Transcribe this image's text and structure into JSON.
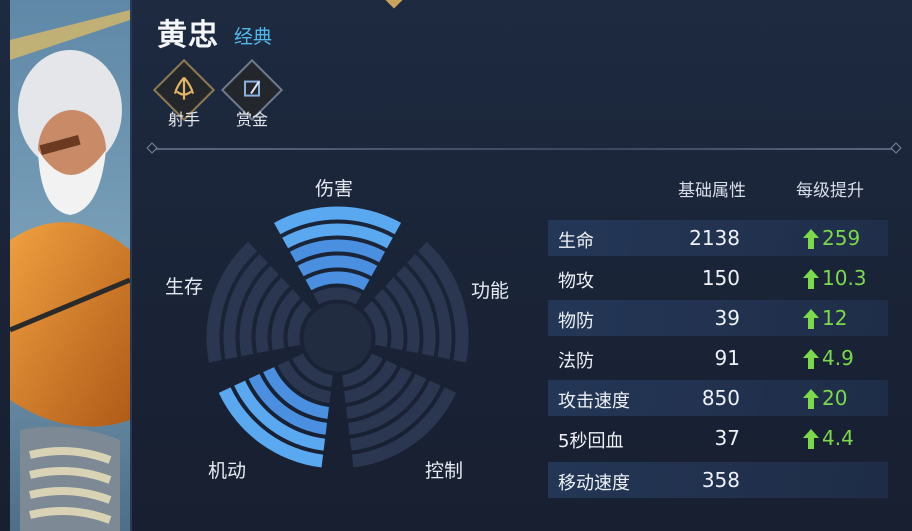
{
  "hero": {
    "name": "黄忠",
    "skin": "经典",
    "roles": [
      {
        "label": "射手",
        "icon": "archer-icon"
      },
      {
        "label": "赏金",
        "icon": "bounty-icon"
      }
    ]
  },
  "radar": {
    "labels": {
      "damage": "伤害",
      "ability": "功能",
      "control": "控制",
      "mobility": "机动",
      "survival": "生存"
    },
    "levels": {
      "damage": 5,
      "ability": 0,
      "control": 0,
      "mobility": 4,
      "survival": 0
    }
  },
  "stats": {
    "header_base": "基础属性",
    "header_growth": "每级提升",
    "rows": [
      {
        "name": "生命",
        "base": "2138",
        "growth": "259"
      },
      {
        "name": "物攻",
        "base": "150",
        "growth": "10.3"
      },
      {
        "name": "物防",
        "base": "39",
        "growth": "12"
      },
      {
        "name": "法防",
        "base": "91",
        "growth": "4.9"
      },
      {
        "name": "攻击速度",
        "base": "850",
        "growth": "20"
      },
      {
        "name": "5秒回血",
        "base": "37",
        "growth": "4.4"
      },
      {
        "name": "移动速度",
        "base": "358",
        "growth": ""
      }
    ]
  },
  "colors": {
    "accent_blue": "#4fb8ea",
    "growth_green": "#7bd94b",
    "radar_active": "#4a8fe0",
    "radar_inactive": "#2b3650"
  }
}
